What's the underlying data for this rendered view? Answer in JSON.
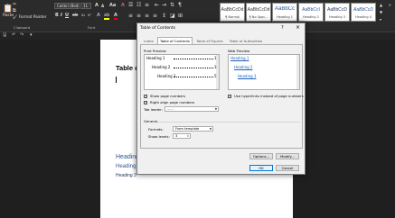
{
  "ribbon": {
    "paste_label": "Paste",
    "cut_icon": "scissors-icon",
    "copy_label": "Copy",
    "format_painter_label": "Format Painter",
    "font_name": "Calibri (Body)",
    "font_size": "11",
    "styles": [
      {
        "preview": "AaBbCcDd",
        "name": "¶ Normal"
      },
      {
        "preview": "AaBbCcDd",
        "name": "¶ No Spac..."
      },
      {
        "preview": "AaBbCc",
        "name": "Heading 1"
      },
      {
        "preview": "AaBbCcI",
        "name": "Heading 2"
      },
      {
        "preview": "AaBbCcD",
        "name": "Heading 3"
      },
      {
        "preview": "AaBbCcD",
        "name": "Heading 4"
      }
    ],
    "groups": {
      "clipboard": "Clipboard",
      "font": "Font"
    }
  },
  "document": {
    "title": "Table o",
    "heading1": "Heading",
    "heading2": "Heading",
    "heading3": "Heading 3"
  },
  "dialog": {
    "title": "Table of Contents",
    "help": "?",
    "close": "×",
    "tabs": [
      "Index",
      "Table of Contents",
      "Table of Figures",
      "Table of Authorities"
    ],
    "active_tab": "Table of Contents",
    "print_preview_label": "Print Preview",
    "print_entries": [
      {
        "text": "Heading 1",
        "page": "1"
      },
      {
        "text": "Heading 2",
        "page": "3"
      },
      {
        "text": "Heading 3",
        "page": "5"
      }
    ],
    "web_preview_label": "Web Preview",
    "web_entries": [
      "Heading 1",
      "Heading 2",
      "Heading 3"
    ],
    "show_page_numbers": "Show page numbers",
    "right_align_page_numbers": "Right align page numbers",
    "tab_leader_label": "Tab leader:",
    "tab_leader_value": "......",
    "use_hyperlinks": "Use hyperlinks instead of page numbers",
    "general_label": "General",
    "formats_label": "Formats:",
    "formats_value": "From template",
    "show_levels_label": "Show levels:",
    "show_levels_value": "3",
    "options_button": "Options...",
    "modify_button": "Modify...",
    "ok_button": "OK",
    "cancel_button": "Cancel"
  }
}
